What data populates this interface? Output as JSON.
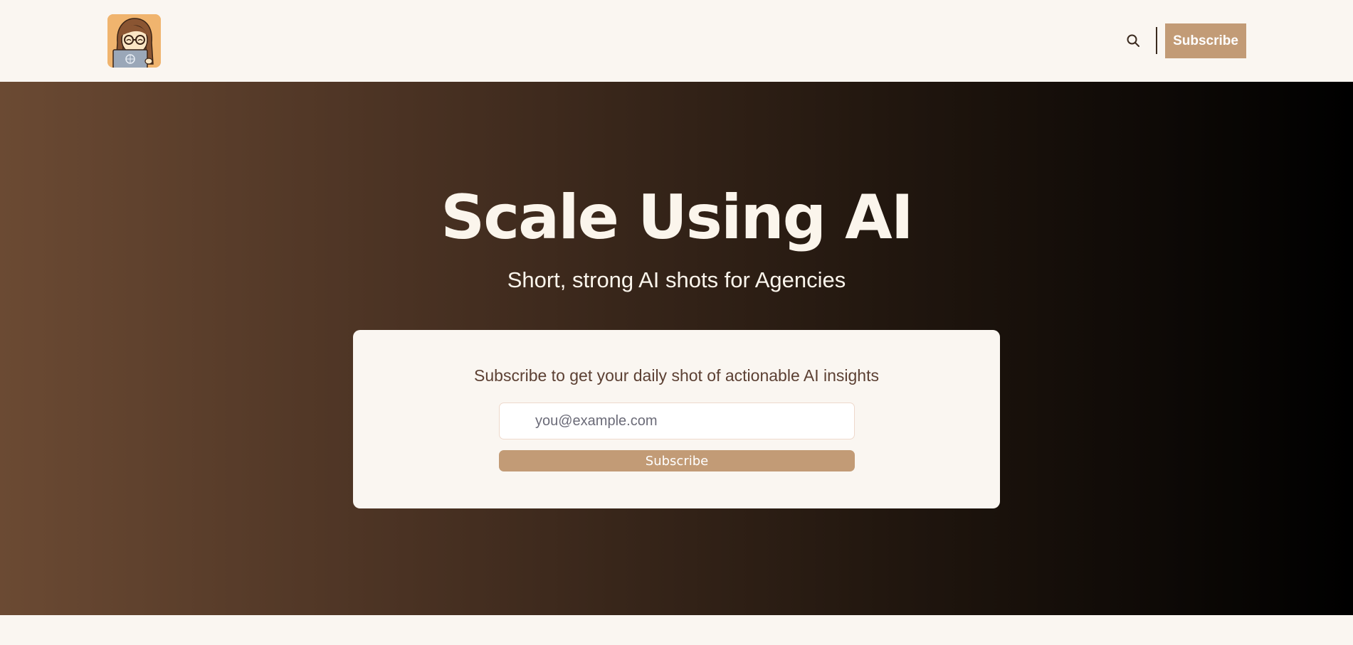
{
  "header": {
    "subscribe_label": "Subscribe",
    "search_icon": "search-icon",
    "logo_icon": "avatar-logo"
  },
  "hero": {
    "title": "Scale Using AI",
    "subtitle": "Short, strong AI shots for Agencies"
  },
  "signup": {
    "prompt": "Subscribe to get your daily shot of actionable AI insights",
    "email_placeholder": "you@example.com",
    "subscribe_label": "Subscribe"
  },
  "colors": {
    "accent": "#c29b76",
    "background": "#faf6f1",
    "hero_gradient_start": "#6b4a33",
    "hero_gradient_end": "#000000",
    "text_brown": "#5c4033"
  }
}
